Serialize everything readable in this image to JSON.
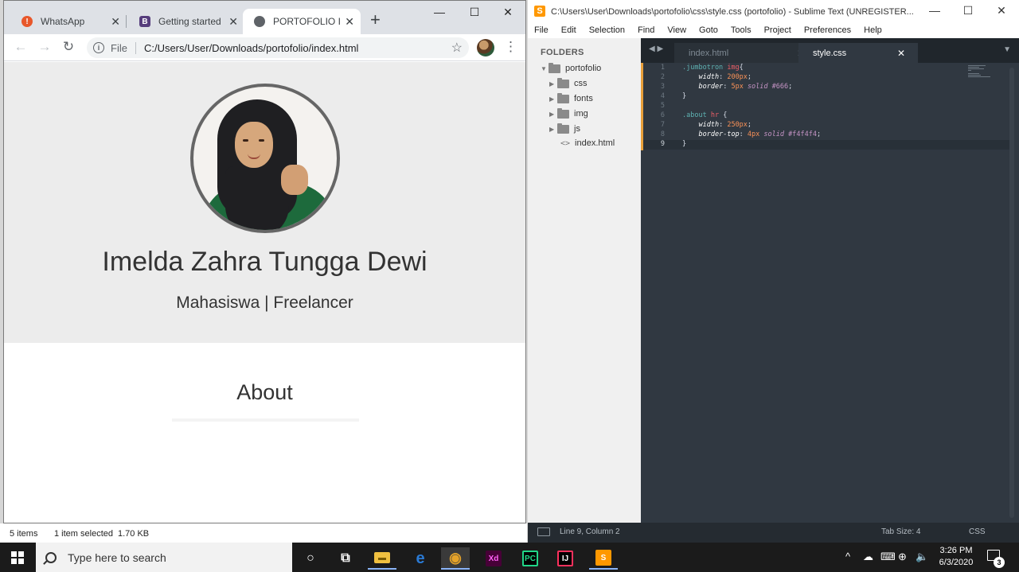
{
  "chrome": {
    "tabs": [
      {
        "title": "WhatsApp",
        "favicon_color": "#e8572a",
        "favicon_glyph": "!"
      },
      {
        "title": "Getting started · B",
        "favicon_color": "#563d7c",
        "favicon_glyph": "B"
      },
      {
        "title": "PORTOFOLIO IM",
        "favicon_color": "#5f6368",
        "favicon_glyph": "◍",
        "active": true
      }
    ],
    "new_tab": "+",
    "window_controls": {
      "minimize": "—",
      "maximize": "☐",
      "close": "✕"
    },
    "nav": {
      "back": "←",
      "forward": "→",
      "reload": "↻"
    },
    "omnibox": {
      "scheme_label": "File",
      "url": "C:/Users/User/Downloads/portofolio/index.html",
      "info": "i",
      "bookmark": "☆"
    },
    "menu": "⋮",
    "page": {
      "name": "Imelda Zahra Tungga Dewi",
      "subtitle": "Mahasiswa | Freelancer",
      "about_heading": "About"
    }
  },
  "explorer_status": {
    "items": "5 items",
    "selected": "1 item selected",
    "size": "1.70 KB"
  },
  "sublime": {
    "title": "C:\\Users\\User\\Downloads\\portofolio\\css\\style.css (portofolio) - Sublime Text (UNREGISTER...",
    "logo": "S",
    "menu": [
      "File",
      "Edit",
      "Selection",
      "Find",
      "View",
      "Goto",
      "Tools",
      "Project",
      "Preferences",
      "Help"
    ],
    "sidebar": {
      "header": "FOLDERS",
      "root": "portofolio",
      "folders": [
        "css",
        "fonts",
        "img",
        "js"
      ],
      "file": "index.html",
      "file_glyph": "<>"
    },
    "tabs": [
      {
        "label": "index.html",
        "active": false
      },
      {
        "label": "style.css",
        "active": true
      }
    ],
    "tab_nav": "◀ ▶",
    "tab_menu": "▼",
    "line_numbers": [
      "1",
      "2",
      "3",
      "4",
      "5",
      "6",
      "7",
      "8",
      "9"
    ],
    "current_line": 9,
    "status": {
      "position": "Line 9, Column 2",
      "tab_size": "Tab Size: 4",
      "syntax": "CSS"
    },
    "accent": "#e8a03a"
  },
  "taskbar": {
    "search_placeholder": "Type here to search",
    "apps": [
      {
        "name": "cortana",
        "glyph": "○"
      },
      {
        "name": "task-view",
        "glyph": "⧉"
      },
      {
        "name": "file-explorer",
        "glyph": "▬",
        "color": "#f0c040"
      },
      {
        "name": "edge",
        "glyph": "e",
        "color": "#2a7ad4"
      },
      {
        "name": "chrome",
        "glyph": "◉",
        "color": "#e5a32a"
      },
      {
        "name": "adobe-xd",
        "glyph": "Xd",
        "color": "#470137"
      },
      {
        "name": "pycharm",
        "glyph": "PC",
        "color": "#21d789"
      },
      {
        "name": "intellij",
        "glyph": "IJ",
        "color": "#fe315d"
      },
      {
        "name": "sublime",
        "glyph": "S",
        "color": "#ff9800"
      }
    ],
    "tray_icons": [
      "^",
      "☁",
      "⌨",
      "⊕",
      "🔈"
    ],
    "time": "3:26 PM",
    "date": "6/3/2020",
    "notifications": "3"
  }
}
